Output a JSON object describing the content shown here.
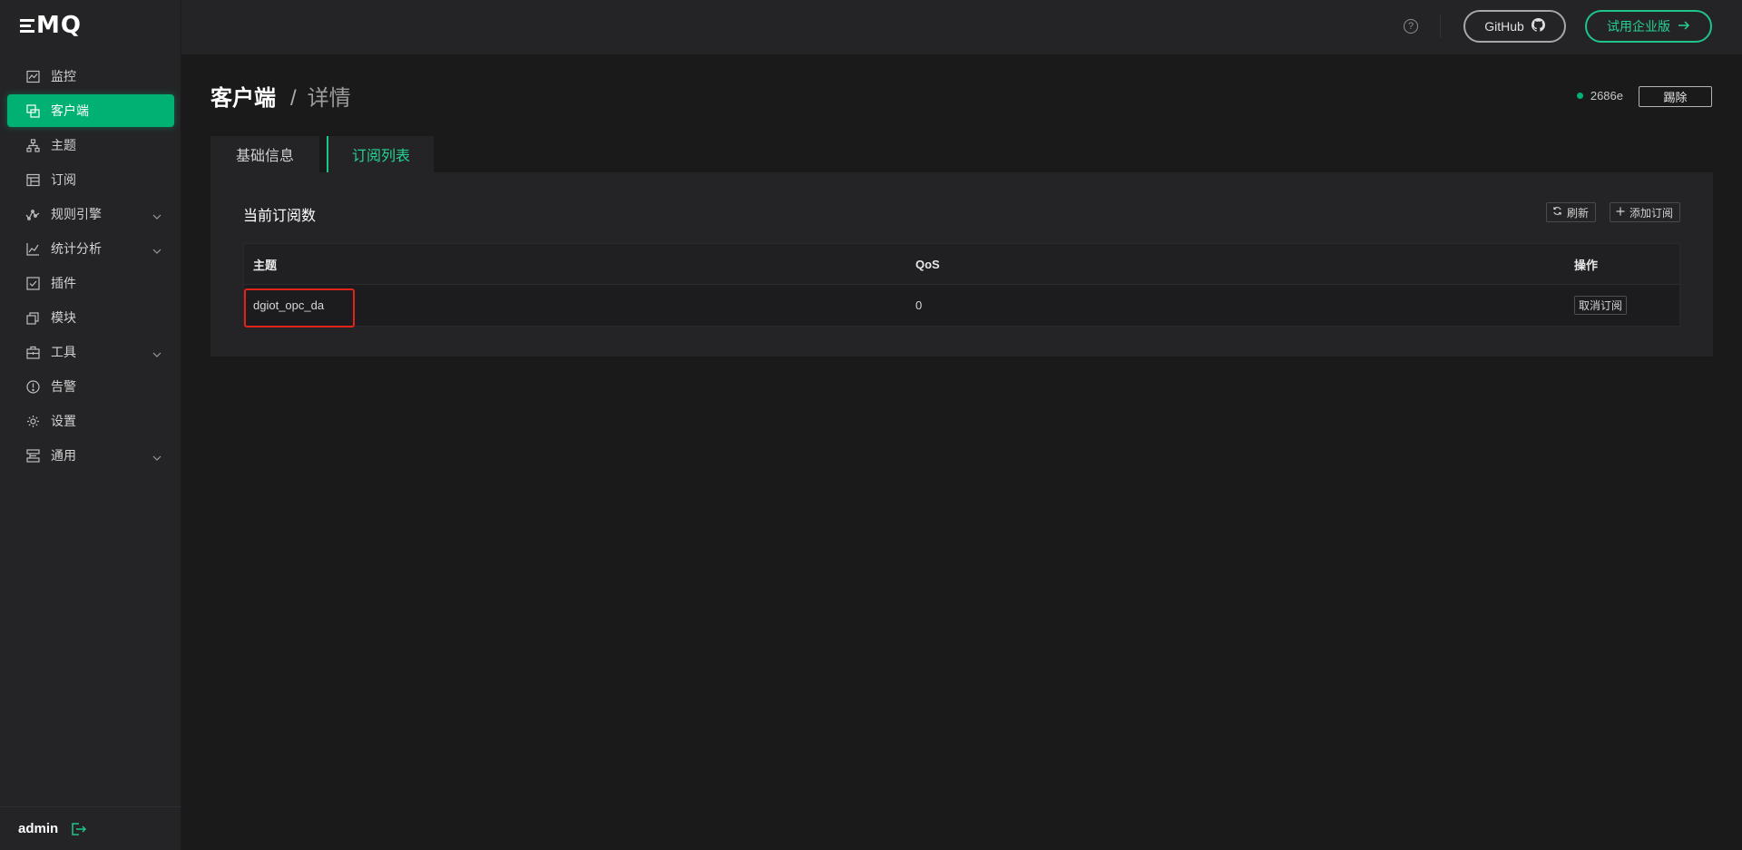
{
  "brand": {
    "logo_text": "MQ"
  },
  "sidebar": {
    "items": [
      {
        "label": "监控",
        "icon": "monitor-icon",
        "active": false,
        "expandable": false
      },
      {
        "label": "客户端",
        "icon": "clients-icon",
        "active": true,
        "expandable": false
      },
      {
        "label": "主题",
        "icon": "topics-icon",
        "active": false,
        "expandable": false
      },
      {
        "label": "订阅",
        "icon": "subscriptions-icon",
        "active": false,
        "expandable": false
      },
      {
        "label": "规则引擎",
        "icon": "rule-engine-icon",
        "active": false,
        "expandable": true
      },
      {
        "label": "统计分析",
        "icon": "analytics-icon",
        "active": false,
        "expandable": true
      },
      {
        "label": "插件",
        "icon": "plugins-icon",
        "active": false,
        "expandable": false
      },
      {
        "label": "模块",
        "icon": "modules-icon",
        "active": false,
        "expandable": false
      },
      {
        "label": "工具",
        "icon": "tools-icon",
        "active": false,
        "expandable": true
      },
      {
        "label": "告警",
        "icon": "alarm-icon",
        "active": false,
        "expandable": false
      },
      {
        "label": "设置",
        "icon": "settings-icon",
        "active": false,
        "expandable": false
      },
      {
        "label": "通用",
        "icon": "general-icon",
        "active": false,
        "expandable": true
      }
    ],
    "user": "admin"
  },
  "header": {
    "help": "?",
    "github_label": "GitHub",
    "trial_label": "试用企业版"
  },
  "page": {
    "title": "客户端",
    "separator": "/",
    "subtitle": "详情",
    "client_id": "2686e",
    "kick_label": "踢除"
  },
  "tabs": [
    {
      "label": "基础信息",
      "active": false
    },
    {
      "label": "订阅列表",
      "active": true
    }
  ],
  "subscriptions": {
    "title": "当前订阅数",
    "refresh_label": "刷新",
    "add_label": "添加订阅",
    "columns": [
      "主题",
      "QoS",
      "操作"
    ],
    "rows": [
      {
        "topic": "dgiot_opc_da",
        "qos": "0",
        "action": "取消订阅"
      }
    ]
  },
  "colors": {
    "accent": "#00b173",
    "accent_text": "#24d393",
    "highlight": "#e2231a",
    "sidebar_bg": "#242427",
    "page_bg": "#1a1a1b"
  }
}
